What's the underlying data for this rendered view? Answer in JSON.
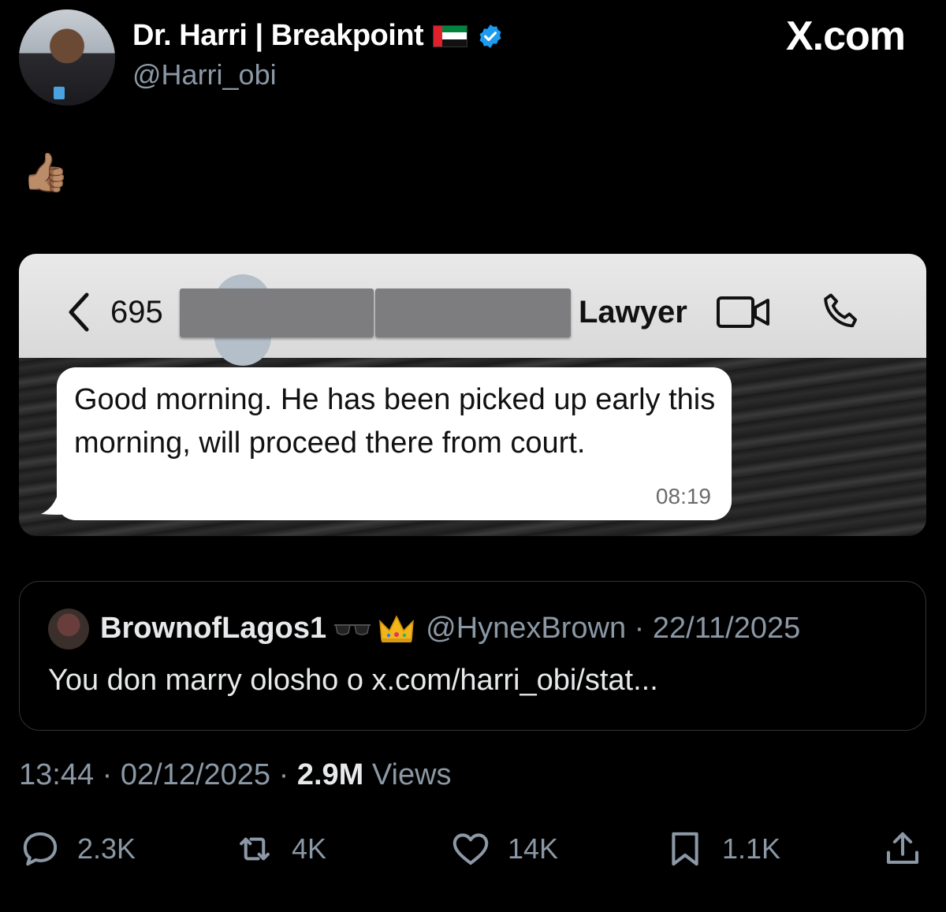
{
  "author": {
    "display_name": "Dr. Harri | Breakpoint",
    "handle": "@Harri_obi",
    "flag_icon": "uae-flag-icon",
    "verified_icon": "verified-badge-icon"
  },
  "source_label": "X.com",
  "tweet_text": "👍🏽",
  "media": {
    "chat_header": {
      "back_count": "695",
      "contact_suffix": "Lawyer",
      "video_icon": "video-call-icon",
      "phone_icon": "phone-call-icon"
    },
    "message": {
      "text": "Good morning. He has been picked up early this morning, will proceed there from court.",
      "time": "08:19"
    }
  },
  "quoted": {
    "name": "BrownofLagos1",
    "emoji_icons": [
      "sunglasses-icon",
      "crown-icon"
    ],
    "meta": "@HynexBrown · 22/11/2025",
    "text": "You don marry olosho o x.com/harri_obi/stat..."
  },
  "meta": {
    "time_date": "13:44 · 02/12/2025 · ",
    "views_count": "2.9M",
    "views_label": " Views"
  },
  "actions": {
    "replies": "2.3K",
    "reposts": "4K",
    "likes": "14K",
    "bookmarks": "1.1K"
  },
  "colors": {
    "background": "#000000",
    "verified": "#1d9bf0",
    "secondary_text": "#8b98a5"
  }
}
